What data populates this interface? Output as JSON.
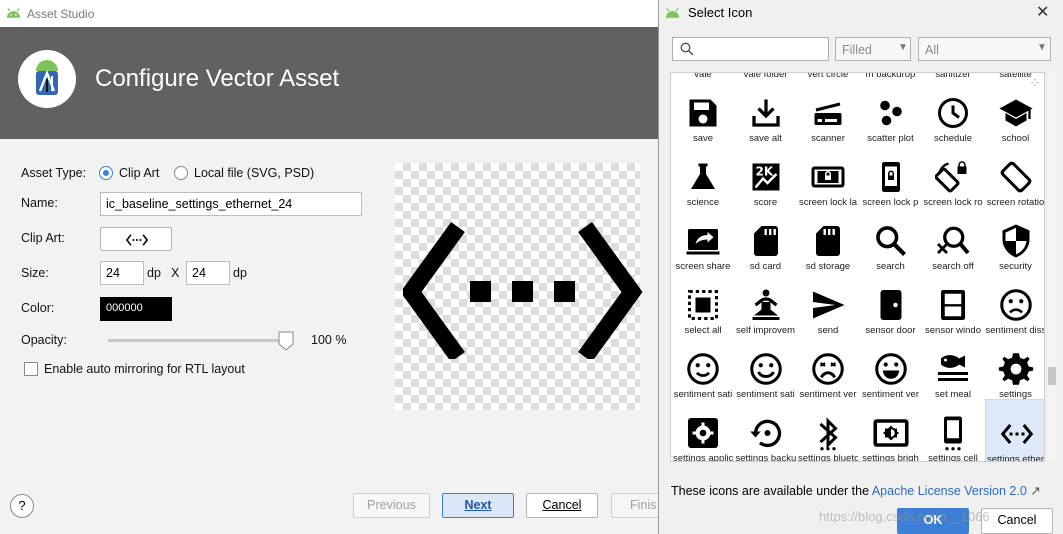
{
  "asset_studio": {
    "title": "Asset Studio",
    "header": "Configure Vector Asset",
    "asset_type_label": "Asset Type:",
    "asset_type_options": [
      "Clip Art",
      "Local file (SVG, PSD)"
    ],
    "asset_type_selected": "Clip Art",
    "name_label": "Name:",
    "name_value": "ic_baseline_settings_ethernet_24",
    "clip_art_label": "Clip Art:",
    "size_label": "Size:",
    "size_width": "24",
    "size_height": "24",
    "dp": "dp",
    "x": "X",
    "color_label": "Color:",
    "color_value": "000000",
    "opacity_label": "Opacity:",
    "opacity_value": "100 %",
    "opacity_level": 1.0,
    "mirror_label": "Enable auto mirroring for RTL layout",
    "mirror_checked": false,
    "buttons": {
      "help": "?",
      "previous": "Previous",
      "next": "Next",
      "cancel": "Cancel",
      "finish": "Finis"
    },
    "colors": {
      "banner": "#616161",
      "accent": "#3d7fd6",
      "android_green": "#7cc35a"
    }
  },
  "select_icon": {
    "title": "Select Icon",
    "search_placeholder": "",
    "style_select": "Filled",
    "category_select": "All",
    "partial_row": [
      "vale",
      "vale folder",
      "vert circle",
      "m backdrop",
      "sanitizer",
      "satellite"
    ],
    "icons": [
      {
        "label": "save",
        "icon": "save-icon"
      },
      {
        "label": "save alt",
        "icon": "save-alt-icon"
      },
      {
        "label": "scanner",
        "icon": "scanner-icon"
      },
      {
        "label": "scatter plot",
        "icon": "scatter-plot-icon"
      },
      {
        "label": "schedule",
        "icon": "schedule-icon"
      },
      {
        "label": "school",
        "icon": "school-icon"
      },
      {
        "label": "science",
        "icon": "science-icon"
      },
      {
        "label": "score",
        "icon": "score-icon"
      },
      {
        "label": "screen lock la",
        "icon": "screen-lock-landscape-icon"
      },
      {
        "label": "screen lock p",
        "icon": "screen-lock-portrait-icon"
      },
      {
        "label": "screen lock ro",
        "icon": "screen-lock-rotation-icon"
      },
      {
        "label": "screen rotatio",
        "icon": "screen-rotation-icon"
      },
      {
        "label": "screen share",
        "icon": "screen-share-icon"
      },
      {
        "label": "sd card",
        "icon": "sd-card-icon"
      },
      {
        "label": "sd storage",
        "icon": "sd-storage-icon"
      },
      {
        "label": "search",
        "icon": "search-icon"
      },
      {
        "label": "search off",
        "icon": "search-off-icon"
      },
      {
        "label": "security",
        "icon": "security-icon"
      },
      {
        "label": "select all",
        "icon": "select-all-icon"
      },
      {
        "label": "self improvem",
        "icon": "self-improvement-icon"
      },
      {
        "label": "send",
        "icon": "send-icon"
      },
      {
        "label": "sensor door",
        "icon": "sensor-door-icon"
      },
      {
        "label": "sensor windo",
        "icon": "sensor-window-icon"
      },
      {
        "label": "sentiment diss",
        "icon": "sentiment-dissatisfied-icon"
      },
      {
        "label": "sentiment sati",
        "icon": "sentiment-satisfied-icon"
      },
      {
        "label": "sentiment sati",
        "icon": "sentiment-satisfied-alt-icon"
      },
      {
        "label": "sentiment ver",
        "icon": "sentiment-very-dissatisfied-icon"
      },
      {
        "label": "sentiment ver",
        "icon": "sentiment-very-satisfied-icon"
      },
      {
        "label": "set meal",
        "icon": "set-meal-icon"
      },
      {
        "label": "settings",
        "icon": "settings-icon"
      },
      {
        "label": "settings applic",
        "icon": "settings-applications-icon"
      },
      {
        "label": "settings backu",
        "icon": "settings-backup-restore-icon"
      },
      {
        "label": "settings blueto",
        "icon": "settings-bluetooth-icon"
      },
      {
        "label": "settings brigh",
        "icon": "settings-brightness-icon"
      },
      {
        "label": "settings cell",
        "icon": "settings-cell-icon"
      },
      {
        "label": "settings ether",
        "icon": "settings-ethernet-icon",
        "selected": true
      }
    ],
    "license_text": "These icons are available under the",
    "license_link": "Apache License Version 2.0",
    "license_arrow": "↗",
    "ok": "OK",
    "cancel": "Cancel",
    "watermark": "https://blog.csdn.net/a__1066"
  }
}
